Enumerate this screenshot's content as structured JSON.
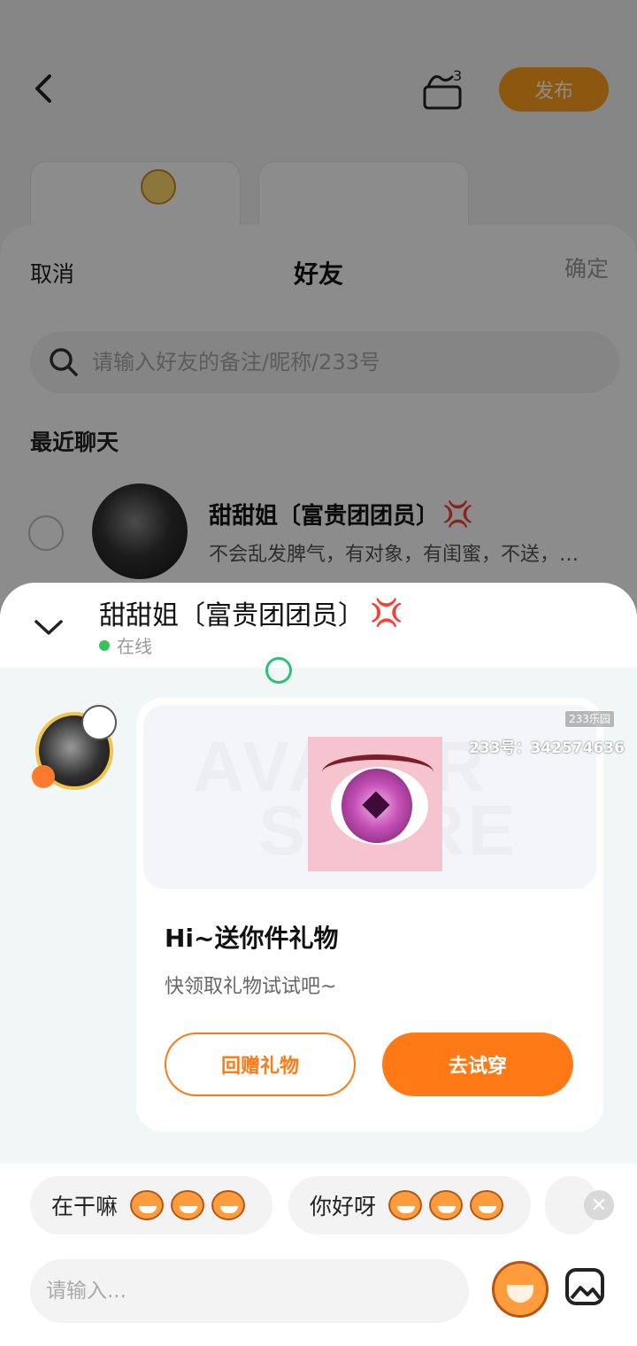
{
  "background": {
    "publish_label": "发布",
    "drafts_count": "3"
  },
  "friend_picker": {
    "cancel_label": "取消",
    "title": "好友",
    "confirm_label": "确定",
    "search_placeholder": "请输入好友的备注/昵称/233号",
    "section_title": "最近聊天",
    "friends": [
      {
        "name": "甜甜姐〔富贵团团员〕",
        "emoji": "💢",
        "desc": "不会乱发脾气，有对象，有闺蜜，不送，…"
      }
    ]
  },
  "chat": {
    "contact_name": "甜甜姐〔富贵团团员〕",
    "contact_emoji": "💢",
    "status": "在线",
    "gift_card": {
      "watermark_line1": "AVATAR",
      "watermark_line2": "STORE",
      "title": "Hi~送你件礼物",
      "subtitle": "快领取礼物试试吧~",
      "return_gift_label": "回赠礼物",
      "try_on_label": "去试穿"
    },
    "quick_replies": [
      "在干嘛",
      "你好呀"
    ],
    "input_placeholder": "请输入..."
  },
  "watermark": {
    "logo": "233乐园",
    "id_text": "233号：342574636"
  },
  "colors": {
    "accent": "#ff7a16",
    "online": "#35c35a",
    "publish": "#ff9e1b"
  }
}
